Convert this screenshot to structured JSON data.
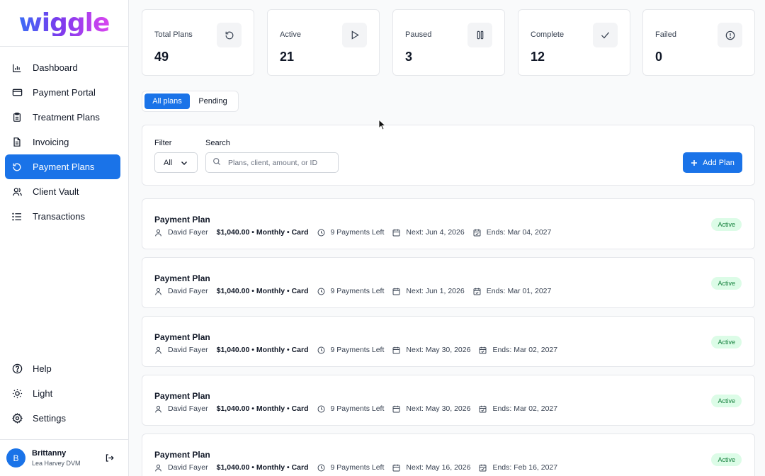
{
  "app": {
    "logo_text": "wiggle"
  },
  "sidebar": {
    "items": [
      {
        "label": "Dashboard",
        "icon": "bar-chart-icon"
      },
      {
        "label": "Payment Portal",
        "icon": "credit-card-icon"
      },
      {
        "label": "Treatment Plans",
        "icon": "clipboard-icon"
      },
      {
        "label": "Invoicing",
        "icon": "document-icon"
      },
      {
        "label": "Payment Plans",
        "icon": "refresh-icon",
        "active": true
      },
      {
        "label": "Client Vault",
        "icon": "users-icon"
      },
      {
        "label": "Transactions",
        "icon": "list-icon"
      }
    ],
    "bottom_items": [
      {
        "label": "Help",
        "icon": "help-icon"
      },
      {
        "label": "Light",
        "icon": "sun-icon"
      },
      {
        "label": "Settings",
        "icon": "gear-icon"
      }
    ],
    "user": {
      "initial": "B",
      "name": "Brittanny",
      "subtitle": "Lea Harvey DVM"
    }
  },
  "stats": [
    {
      "label": "Total Plans",
      "value": "49",
      "icon": "refresh-icon"
    },
    {
      "label": "Active",
      "value": "21",
      "icon": "play-icon"
    },
    {
      "label": "Paused",
      "value": "3",
      "icon": "pause-icon"
    },
    {
      "label": "Complete",
      "value": "12",
      "icon": "check-icon"
    },
    {
      "label": "Failed",
      "value": "0",
      "icon": "alert-circle-icon"
    }
  ],
  "tabs": [
    {
      "label": "All plans",
      "active": true
    },
    {
      "label": "Pending",
      "active": false
    }
  ],
  "filter": {
    "filter_label": "Filter",
    "filter_value": "All",
    "search_label": "Search",
    "search_placeholder": "Plans, client, amount, or ID",
    "add_button": "Add Plan"
  },
  "plans": [
    {
      "title": "Payment Plan",
      "client": "David Fayer",
      "amount": "$1,040.00 • Monthly • Card",
      "remaining": "9 Payments Left",
      "next": "Next: Jun 4, 2026",
      "ends": "Ends: Mar 04, 2027",
      "status": "Active"
    },
    {
      "title": "Payment Plan",
      "client": "David Fayer",
      "amount": "$1,040.00 • Monthly • Card",
      "remaining": "9 Payments Left",
      "next": "Next: Jun 1, 2026",
      "ends": "Ends: Mar 01, 2027",
      "status": "Active"
    },
    {
      "title": "Payment Plan",
      "client": "David Fayer",
      "amount": "$1,040.00 • Monthly • Card",
      "remaining": "9 Payments Left",
      "next": "Next: May 30, 2026",
      "ends": "Ends: Mar 02, 2027",
      "status": "Active"
    },
    {
      "title": "Payment Plan",
      "client": "David Fayer",
      "amount": "$1,040.00 • Monthly • Card",
      "remaining": "9 Payments Left",
      "next": "Next: May 30, 2026",
      "ends": "Ends: Mar 02, 2027",
      "status": "Active"
    },
    {
      "title": "Payment Plan",
      "client": "David Fayer",
      "amount": "$1,040.00 • Monthly • Card",
      "remaining": "9 Payments Left",
      "next": "Next: May 16, 2026",
      "ends": "Ends: Feb 16, 2027",
      "status": "Active"
    }
  ],
  "colors": {
    "accent": "#1a73e8",
    "active_badge_bg": "#dcfce7",
    "active_badge_text": "#15803d"
  }
}
